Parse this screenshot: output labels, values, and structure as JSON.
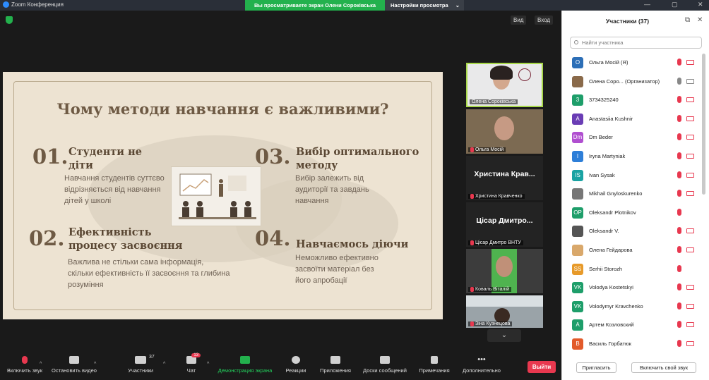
{
  "window": {
    "title": "Zoom Конференция",
    "share_banner": "Вы просматриваете экран Олени Сороківська",
    "view_options": "Настройки просмотра"
  },
  "meeting": {
    "view_btn": "Вид",
    "exit_btn": "Вход"
  },
  "slide": {
    "title": "Чому методи навчання є важливими?",
    "sections": [
      {
        "num": "01.",
        "heading": "Студенти не діти",
        "body": "Навчання студентів суттєво відрізняється від навчання дітей у школі"
      },
      {
        "num": "02.",
        "heading": "Ефективність процесу засвоєння",
        "body": "Важлива не стільки сама інформація, скільки ефективність її засвоєння та глибина розуміння"
      },
      {
        "num": "03.",
        "heading": "Вибір оптимального методу",
        "body": "Вибір залежить від аудиторії та завдань навчання"
      },
      {
        "num": "04.",
        "heading": "Навчаємось діючи",
        "body": "Неможливо ефективно засвоїти матеріал без його апробації"
      }
    ]
  },
  "thumbnails": [
    {
      "name": "Олена Сороківська",
      "type": "video"
    },
    {
      "name": "Ольга Мосій",
      "type": "video"
    },
    {
      "name": "Христина Кравченко",
      "big": "Христина Крав...",
      "type": "name"
    },
    {
      "name": "Цісар Дмитро ВНТУ",
      "big": "Цісар Дмитро...",
      "type": "name"
    },
    {
      "name": "Коваль Віталій",
      "type": "video"
    },
    {
      "name": "Зіна Кузнецова",
      "type": "video"
    }
  ],
  "toolbar": {
    "mute": "Включить звук",
    "video": "Остановить видео",
    "participants": "Участники",
    "participants_count": "37",
    "chat": "Чат",
    "chat_badge": "13",
    "share": "Демонстрация экрана",
    "reactions": "Реакции",
    "apps": "Приложения",
    "whiteboards": "Доски сообщений",
    "notes": "Примечания",
    "more": "Дополнительно",
    "leave": "Выйти"
  },
  "panel": {
    "title": "Участники (37)",
    "search_placeholder": "Найти участника",
    "invite": "Пригласить",
    "unmute_me": "Включить свой звук",
    "participants": [
      {
        "initials": "О",
        "name": "Ольга Мосій (Я)",
        "color": "#2d6fb7",
        "mic": "off",
        "cam": "off"
      },
      {
        "initials": "",
        "name": "Олена Сорo...  (Организатор)",
        "color": "#8a6a4a",
        "mic": "on",
        "cam": "on"
      },
      {
        "initials": "3",
        "name": "3734325240",
        "color": "#1e9e6a",
        "mic": "off",
        "cam": "off"
      },
      {
        "initials": "A",
        "name": "Anastasiia Kushnir",
        "color": "#6a3db5",
        "mic": "off",
        "cam": "off"
      },
      {
        "initials": "Dm",
        "name": "Dm Beder",
        "color": "#b04fd0",
        "mic": "off",
        "cam": "off"
      },
      {
        "initials": "I",
        "name": "Iryna Martyniak",
        "color": "#2e7fd8",
        "mic": "off",
        "cam": "off"
      },
      {
        "initials": "IS",
        "name": "Ivan Sysak",
        "color": "#1aa3a3",
        "mic": "off",
        "cam": "off"
      },
      {
        "initials": "",
        "name": "Mikhail Gnyloskurenko",
        "color": "#777777",
        "mic": "off",
        "cam": "off"
      },
      {
        "initials": "OP",
        "name": "Oleksandr Plotnikov",
        "color": "#1e9e6a",
        "mic": "off",
        "cam": "none"
      },
      {
        "initials": "",
        "name": "Oleksandr V.",
        "color": "#555555",
        "mic": "off",
        "cam": "off"
      },
      {
        "initials": "",
        "name": "Олена Гейдарова",
        "color": "#d9a86b",
        "mic": "off",
        "cam": "off"
      },
      {
        "initials": "SS",
        "name": "Serhii Storozh",
        "color": "#e79a2a",
        "mic": "off",
        "cam": "none"
      },
      {
        "initials": "VK",
        "name": "Volodya Kostetskyi",
        "color": "#1e9e6a",
        "mic": "off",
        "cam": "off"
      },
      {
        "initials": "VK",
        "name": "Volodymyr Kravchenko",
        "color": "#1e9e6a",
        "mic": "off",
        "cam": "off"
      },
      {
        "initials": "A",
        "name": "Артем Козловский",
        "color": "#1e9e6a",
        "mic": "off",
        "cam": "off"
      },
      {
        "initials": "B",
        "name": "Василь Горбатюк",
        "color": "#e25a2a",
        "mic": "off",
        "cam": "off"
      }
    ]
  }
}
